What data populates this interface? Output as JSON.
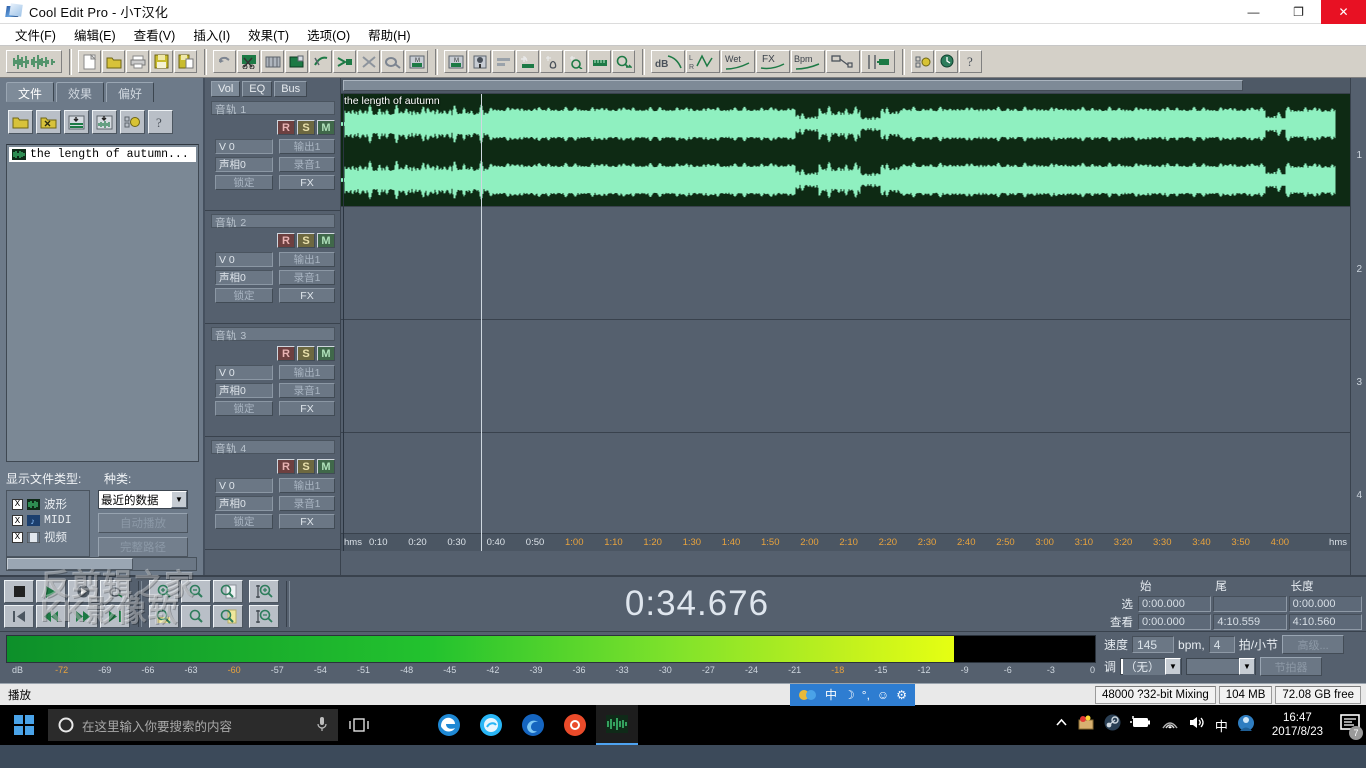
{
  "window": {
    "title": "Cool Edit Pro  - 小T汉化",
    "app_icon": "waveform-app-icon",
    "minimize": "—",
    "maximize": "❐",
    "close": "✕"
  },
  "menu": {
    "items": [
      {
        "label": "文件(F)",
        "name": "menu-file"
      },
      {
        "label": "编辑(E)",
        "name": "menu-edit"
      },
      {
        "label": "查看(V)",
        "name": "menu-view"
      },
      {
        "label": "插入(I)",
        "name": "menu-insert"
      },
      {
        "label": "效果(T)",
        "name": "menu-effects"
      },
      {
        "label": "选项(O)",
        "name": "menu-options"
      },
      {
        "label": "帮助(H)",
        "name": "menu-help"
      }
    ]
  },
  "toolbar": {
    "groups": [
      {
        "buttons": [
          {
            "icon": "waveform-view-icon",
            "label": ""
          }
        ]
      },
      {
        "buttons": [
          {
            "icon": "new-file-icon",
            "label": ""
          },
          {
            "icon": "open-folder-icon",
            "label": ""
          },
          {
            "icon": "print-icon",
            "label": ""
          },
          {
            "icon": "save-icon",
            "label": ""
          },
          {
            "icon": "save-as-icon",
            "label": ""
          }
        ]
      },
      {
        "buttons": [
          {
            "icon": "undo-icon",
            "label": ""
          },
          {
            "icon": "cut-icon",
            "label": ""
          },
          {
            "icon": "copy-icon",
            "label": ""
          },
          {
            "icon": "paste-icon",
            "label": ""
          },
          {
            "icon": "trim-icon",
            "label": ""
          },
          {
            "icon": "mix-paste-icon",
            "label": ""
          },
          {
            "icon": "delete-silence-icon",
            "label": ""
          },
          {
            "icon": "edit-tool-icon",
            "label": ""
          },
          {
            "icon": "multitrack-icon",
            "label": ""
          }
        ]
      },
      {
        "buttons": [
          {
            "icon": "mix-down-icon",
            "label": ""
          },
          {
            "icon": "insert-track-icon",
            "label": ""
          },
          {
            "icon": "level-icon",
            "label": ""
          },
          {
            "icon": "spectral-icon",
            "label": ""
          },
          {
            "icon": "noise-reduction-icon",
            "label": ""
          },
          {
            "icon": "spectral-freq-icon",
            "label": ""
          },
          {
            "icon": "ruler-icon",
            "label": ""
          },
          {
            "icon": "analyze-icon",
            "label": ""
          }
        ]
      },
      {
        "buttons": [
          {
            "icon": "db-icon",
            "label": "dB"
          },
          {
            "icon": "pan-lr-icon",
            "label": "R L"
          },
          {
            "icon": "wet-icon",
            "label": "Wet"
          },
          {
            "icon": "fx-icon",
            "label": "FX"
          },
          {
            "icon": "bpm-icon",
            "label": "Bpm"
          },
          {
            "icon": "envelope-icon",
            "label": ""
          },
          {
            "icon": "snap-icon",
            "label": ""
          }
        ]
      },
      {
        "buttons": [
          {
            "icon": "options-icon",
            "label": ""
          },
          {
            "icon": "time-window-icon",
            "label": ""
          },
          {
            "icon": "help-icon",
            "label": "?"
          }
        ]
      }
    ]
  },
  "filepanel": {
    "tabs": [
      {
        "label": "文件",
        "active": true
      },
      {
        "label": "效果",
        "active": false
      },
      {
        "label": "偏好",
        "active": false
      }
    ],
    "buttons": [
      {
        "name": "open-file-icon"
      },
      {
        "name": "close-file-icon"
      },
      {
        "name": "insert-into-multitrack-icon"
      },
      {
        "name": "insert-waveform-icon"
      },
      {
        "name": "file-options-icon"
      },
      {
        "name": "file-help-icon"
      }
    ],
    "files": [
      {
        "label": "the length of autumn...",
        "icon": "waveform-file-icon"
      }
    ],
    "filter_title": "显示文件类型:",
    "kind_title": "种类:",
    "filters": [
      {
        "label": "波形",
        "checked": "X",
        "icon": "waveform-type-icon"
      },
      {
        "label": "MIDI",
        "checked": "X",
        "icon": "midi-type-icon"
      },
      {
        "label": "视频",
        "checked": "X",
        "icon": "video-type-icon"
      }
    ],
    "kind_value": "最近的数据",
    "kind_arrow": "▼",
    "autoplay_label": "自动播放",
    "fullpath_label": "完整路径"
  },
  "mixer": {
    "tabs": [
      {
        "label": "Vol",
        "active": true
      },
      {
        "label": "EQ",
        "active": false
      },
      {
        "label": "Bus",
        "active": false
      }
    ],
    "tracks": [
      {
        "name": "音轨 1",
        "r": "R",
        "s": "S",
        "m": "M",
        "vol": "V 0",
        "pan": "声相0",
        "out": "输出1",
        "rec": "录音1",
        "lock": "锁定",
        "fx": "FX"
      },
      {
        "name": "音轨 2",
        "r": "R",
        "s": "S",
        "m": "M",
        "vol": "V 0",
        "pan": "声相0",
        "out": "输出1",
        "rec": "录音1",
        "lock": "锁定",
        "fx": "FX"
      },
      {
        "name": "音轨 3",
        "r": "R",
        "s": "S",
        "m": "M",
        "vol": "V 0",
        "pan": "声相0",
        "out": "输出1",
        "rec": "录音1",
        "lock": "锁定",
        "fx": "FX"
      },
      {
        "name": "音轨 4",
        "r": "R",
        "s": "S",
        "m": "M",
        "vol": "V 0",
        "pan": "声相0",
        "out": "输出1",
        "rec": "录音1",
        "lock": "锁定",
        "fx": "FX"
      }
    ]
  },
  "timeline": {
    "clip_label": "the length of autumn",
    "clip_color": "#0e2a14",
    "waveform_color": "#8ff0c0",
    "track_numbers": [
      "1",
      "2",
      "3",
      "4"
    ],
    "ruler_start": "hms",
    "ruler_end": "hms",
    "ruler_ticks": [
      "0:10",
      "0:20",
      "0:30",
      "0:40",
      "0:50",
      "1:00",
      "1:10",
      "1:20",
      "1:30",
      "1:40",
      "1:50",
      "2:00",
      "2:10",
      "2:20",
      "2:30",
      "2:40",
      "2:50",
      "3:00",
      "3:10",
      "3:20",
      "3:30",
      "3:40",
      "3:50",
      "4:00"
    ]
  },
  "transport": {
    "row1": [
      {
        "name": "stop-button",
        "icon": "stop"
      },
      {
        "name": "play-button",
        "icon": "play"
      },
      {
        "name": "pause-button",
        "icon": "pause"
      },
      {
        "name": "play-loop-button",
        "icon": "loop"
      }
    ],
    "row2": [
      {
        "name": "go-to-start-button",
        "icon": "skip-back"
      },
      {
        "name": "rewind-button",
        "icon": "rewind"
      },
      {
        "name": "fast-forward-button",
        "icon": "ffwd"
      },
      {
        "name": "go-to-end-button",
        "icon": "skip-fwd"
      }
    ],
    "zoom_row1": [
      {
        "name": "zoom-in-horizontal-icon"
      },
      {
        "name": "zoom-out-horizontal-icon"
      },
      {
        "name": "zoom-full-icon"
      }
    ],
    "zoom_row2": [
      {
        "name": "zoom-to-selection-icon"
      },
      {
        "name": "zoom-out-selection-icon"
      },
      {
        "name": "zoom-sel-right-icon"
      }
    ],
    "zoom_vert": [
      {
        "name": "zoom-in-vertical-icon"
      },
      {
        "name": "zoom-out-vertical-icon"
      }
    ],
    "big_time": "0:34.676",
    "watermark": "反剪辑之家\nKK影像软"
  },
  "selection": {
    "headers": [
      "始",
      "尾",
      "长度"
    ],
    "rows": [
      {
        "label": "选",
        "start": "0:00.000",
        "end": "",
        "length": "0:00.000"
      },
      {
        "label": "查看",
        "start": "0:00.000",
        "end": "4:10.559",
        "length": "4:10.560"
      }
    ]
  },
  "meter": {
    "fill_percent": 87,
    "ticks": [
      "dB",
      "-72",
      "-69",
      "-66",
      "-63",
      "-60",
      "-57",
      "-54",
      "-51",
      "-48",
      "-45",
      "-42",
      "-39",
      "-36",
      "-33",
      "-30",
      "-27",
      "-24",
      "-21",
      "-18",
      "-15",
      "-12",
      "-9",
      "-6",
      "-3",
      "0"
    ]
  },
  "tempo": {
    "speed_label": "速度",
    "speed_value": "145",
    "bpm_label": "bpm,",
    "beats_value": "4",
    "beats_label": "拍/小节",
    "advanced_label": "高级...",
    "key_label": "调",
    "key_value": "（无）",
    "key_arrow": "▼",
    "scale_value": "",
    "scale_arrow": "▼",
    "metronome_label": "节拍器"
  },
  "statusbar": {
    "playing": "播放",
    "cells": [
      "48000 ?32-bit Mixing",
      "104 MB",
      "72.08 GB free"
    ],
    "ime": {
      "lang": "中",
      "icons": [
        "moon-icon",
        "punctuation-icon",
        "emoji-icon",
        "gear-icon"
      ]
    }
  },
  "taskbar": {
    "start": "windows-logo-icon",
    "search_placeholder": "在这里输入你要搜索的内容",
    "cortana": "cortana-circle-icon",
    "mic": "microphone-icon",
    "taskview": "task-view-icon",
    "apps": [
      {
        "name": "edge-icon"
      },
      {
        "name": "explorer-icon"
      },
      {
        "name": "firefox-icon"
      },
      {
        "name": "browser-icon"
      },
      {
        "name": "cooledit-icon",
        "active": true
      }
    ],
    "tray": [
      {
        "name": "show-hidden-icons"
      },
      {
        "name": "tray-app-icon"
      },
      {
        "name": "steam-icon"
      },
      {
        "name": "battery-icon"
      },
      {
        "name": "wifi-icon"
      },
      {
        "name": "volume-icon"
      },
      {
        "name": "ime-lang-icon"
      },
      {
        "name": "security-icon"
      }
    ],
    "time": "16:47",
    "date": "2017/8/23",
    "notification_count": "7"
  }
}
